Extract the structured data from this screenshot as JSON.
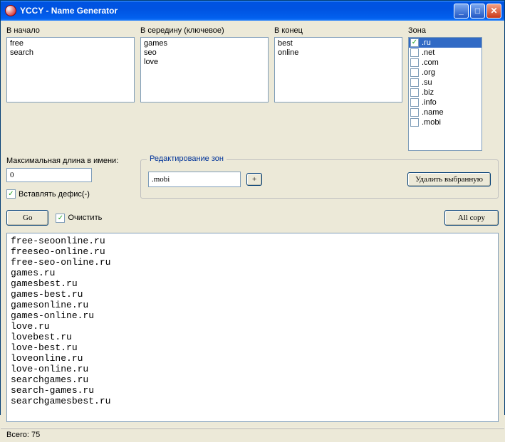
{
  "window": {
    "title": "YCCY - Name Generator"
  },
  "labels": {
    "begin": "В начало",
    "middle": "В середину (ключевое)",
    "end": "В конец",
    "zone": "Зона",
    "maxlen": "Максимальная длина в имени:",
    "hyphen": "Вставлять дефис(-)",
    "editzones": "Редактирование зон",
    "addzone": "+",
    "deletezone": "Удалить выбранную",
    "go": "Go",
    "clear": "Очистить",
    "allcopy": "All copy"
  },
  "inputs": {
    "begin_list": "free\nsearch",
    "middle_list": "games\nseo\nlove",
    "end_list": "best\nonline",
    "maxlen": "0",
    "zone_edit": ".mobi"
  },
  "zones": [
    {
      "label": ".ru",
      "checked": true,
      "selected": true
    },
    {
      "label": ".net",
      "checked": false,
      "selected": false
    },
    {
      "label": ".com",
      "checked": false,
      "selected": false
    },
    {
      "label": ".org",
      "checked": false,
      "selected": false
    },
    {
      "label": ".su",
      "checked": false,
      "selected": false
    },
    {
      "label": ".biz",
      "checked": false,
      "selected": false
    },
    {
      "label": ".info",
      "checked": false,
      "selected": false
    },
    {
      "label": ".name",
      "checked": false,
      "selected": false
    },
    {
      "label": ".mobi",
      "checked": false,
      "selected": false
    }
  ],
  "output": "free-seoonline.ru\nfreeseo-online.ru\nfree-seo-online.ru\ngames.ru\ngamesbest.ru\ngames-best.ru\ngamesonline.ru\ngames-online.ru\nlove.ru\nlovebest.ru\nlove-best.ru\nloveonline.ru\nlove-online.ru\nsearchgames.ru\nsearch-games.ru\nsearchgamesbest.ru",
  "status": "Всего: 75"
}
